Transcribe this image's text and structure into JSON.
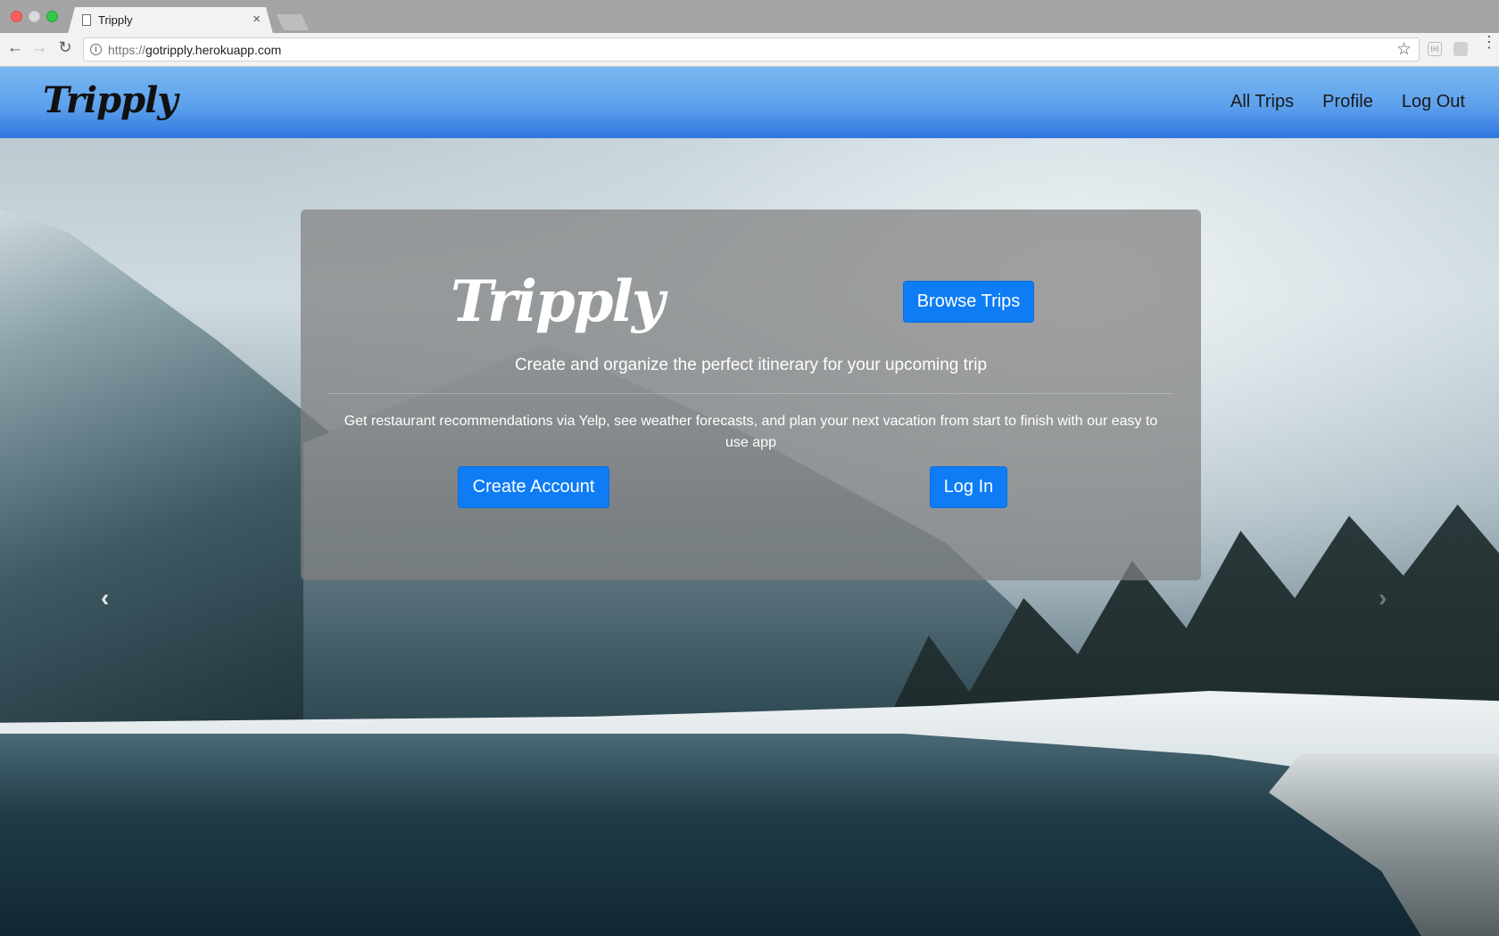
{
  "browser": {
    "tab_title": "Tripply",
    "tab_close": "×",
    "url_scheme": "https://",
    "url_host": "gotripply.herokuapp.com",
    "back_glyph": "←",
    "forward_glyph": "→",
    "reload_glyph": "↻",
    "star_glyph": "☆",
    "menu_glyph": "⋮",
    "ext_text": "{a}"
  },
  "navbar": {
    "brand": "Tripply",
    "links": [
      "All Trips",
      "Profile",
      "Log Out"
    ]
  },
  "hero": {
    "prev_glyph": "‹",
    "next_glyph": "›"
  },
  "card": {
    "brand": "Tripply",
    "browse_button": "Browse Trips",
    "tagline": "Create and organize the perfect itinerary for your upcoming trip",
    "description": "Get restaurant recommendations via Yelp, see weather forecasts, and plan your next vacation from start to finish with our easy to use app",
    "create_button": "Create Account",
    "login_button": "Log In"
  },
  "colors": {
    "primary_button": "#0d7cf5",
    "navbar_top": "#79b7f0",
    "navbar_bottom": "#2f76df"
  }
}
